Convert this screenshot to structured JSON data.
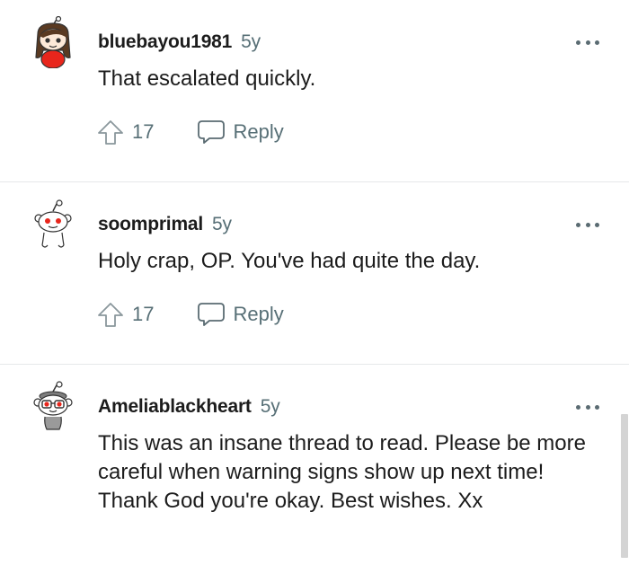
{
  "comments": [
    {
      "username": "bluebayou1981",
      "age": "5y",
      "body": "That escalated quickly.",
      "upvotes": "17",
      "reply_label": "Reply",
      "avatar_icon": "snoo-avatar-brown-hair-red-shirt"
    },
    {
      "username": "soomprimal",
      "age": "5y",
      "body": "Holy crap, OP. You've had quite the day.",
      "upvotes": "17",
      "reply_label": "Reply",
      "avatar_icon": "snoo-avatar-default"
    },
    {
      "username": "Ameliablackheart",
      "age": "5y",
      "body": "This was an insane thread to read. Please be more careful when warning signs show up next time! Thank God you're okay. Best wishes. Xx",
      "avatar_icon": "snoo-avatar-glasses"
    }
  ],
  "icons": {
    "upvote": "upvote-arrow-icon",
    "reply": "reply-bubble-icon",
    "more": "more-options-icon"
  },
  "colors": {
    "meta_text": "#576f76",
    "divider": "#e6e8ea",
    "accent_red": "#e8261c",
    "text": "#1c1c1c"
  }
}
